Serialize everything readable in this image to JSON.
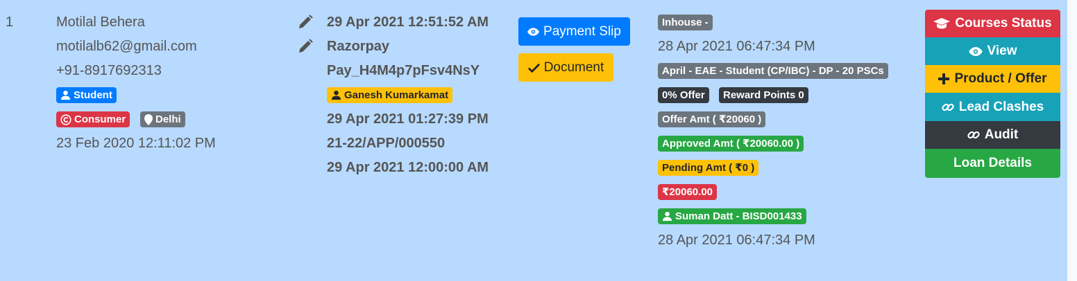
{
  "row_index": "1",
  "customer": {
    "name": "Motilal Behera",
    "email": "motilalb62@gmail.com",
    "phone": "+91-8917692313",
    "role_badge": "Student",
    "type_badge": "Consumer",
    "location_badge": "Delhi",
    "created_at": "23 Feb 2020 12:11:02 PM"
  },
  "payment": {
    "date": "29 Apr 2021 12:51:52 AM",
    "gateway": "Razorpay",
    "transaction_id": "Pay_H4M4p7pFsv4NsY",
    "agent_badge": "Ganesh Kumarkamat",
    "updated_at": "29 Apr 2021 01:27:39 PM",
    "application_no": "21-22/APP/000550",
    "due_date": "29 Apr 2021 12:00:00 AM"
  },
  "buttons": {
    "payment_slip": "Payment Slip",
    "document": "Document"
  },
  "lead": {
    "source_badge": "Inhouse -",
    "source_date": "28 Apr 2021 06:47:34 PM",
    "course_badge": "April - EAE - Student (CP/IBC) - DP - 20 PSCs",
    "offer_badge": "0% Offer",
    "reward_badge": "Reward Points 0",
    "offer_amt_badge": "Offer Amt ( ₹20060 )",
    "approved_amt_badge": "Approved Amt ( ₹20060.00 )",
    "pending_amt_badge": "Pending Amt ( ₹0 )",
    "total_badge": "₹20060.00",
    "counsellor_badge": "Suman Datt - BISD001433",
    "counsellor_date": "28 Apr 2021 06:47:34 PM"
  },
  "actions": {
    "courses_status": "Courses Status",
    "view": "View",
    "product_offer": "Product / Offer",
    "lead_clashes": "Lead Clashes",
    "audit": "Audit",
    "loan_details": "Loan Details"
  },
  "colors": {
    "row_bg": "#b8daff",
    "primary": "#007bff",
    "danger": "#dc3545",
    "secondary": "#6c757d",
    "dark": "#343a40",
    "success": "#28a745",
    "warning": "#ffc107",
    "info": "#17a2b8"
  }
}
